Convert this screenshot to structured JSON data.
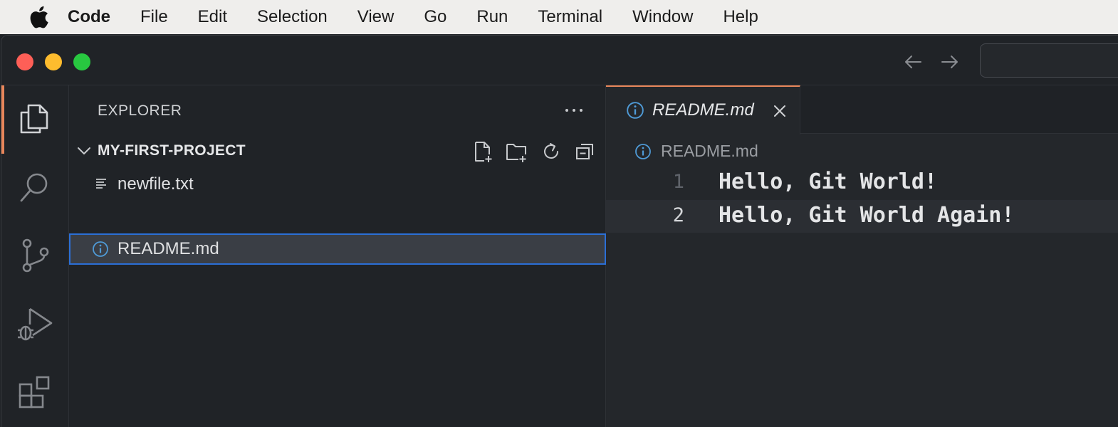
{
  "menubar": {
    "app_name": "Code",
    "items": [
      "File",
      "Edit",
      "Selection",
      "View",
      "Go",
      "Run",
      "Terminal",
      "Window",
      "Help"
    ]
  },
  "sidebar": {
    "title": "EXPLORER",
    "project_name": "MY-FIRST-PROJECT",
    "files": [
      {
        "name": "newfile.txt",
        "icon": "text-file-icon"
      },
      {
        "name": "README.md",
        "icon": "info-icon",
        "selected": true
      }
    ]
  },
  "editor": {
    "tab_label": "README.md",
    "breadcrumb": "README.md",
    "lines": [
      {
        "number": "1",
        "text": "Hello, Git World!"
      },
      {
        "number": "2",
        "text": "Hello, Git World Again!"
      }
    ]
  },
  "colors": {
    "accent": "#e8865a",
    "selection_border": "#2b6fd6",
    "info_icon": "#4f9ad6"
  }
}
